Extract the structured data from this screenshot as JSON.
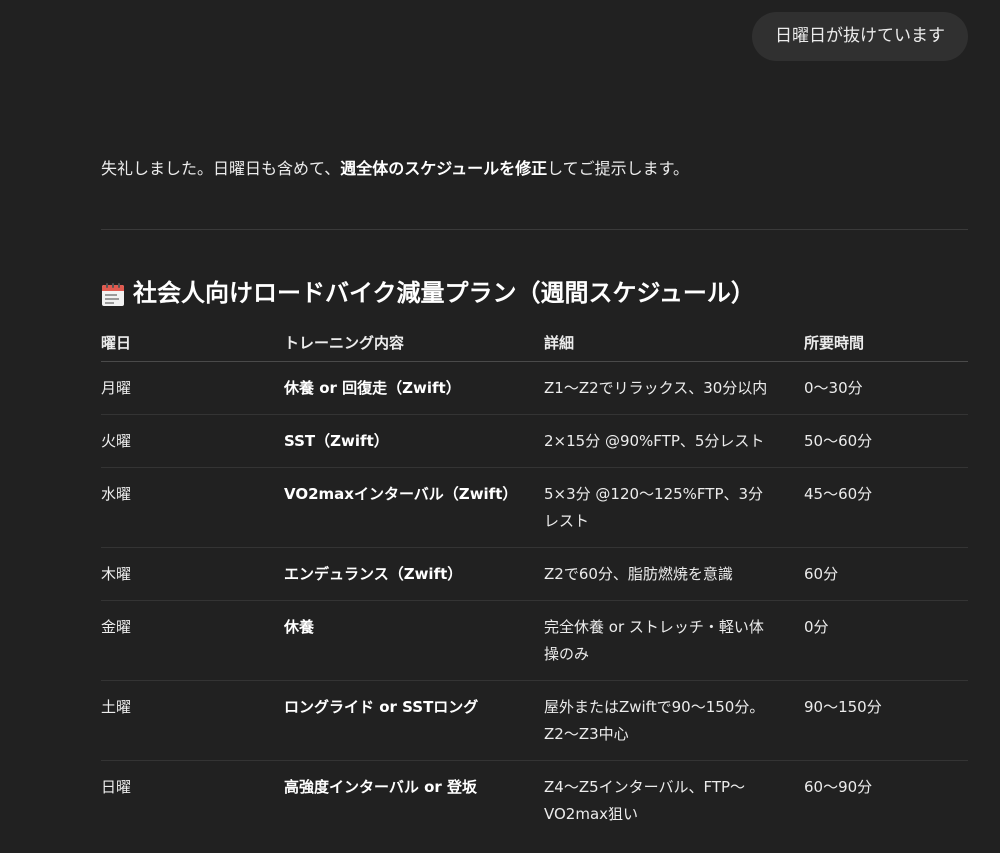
{
  "user_message": "日曜日が抜けています",
  "assistant": {
    "intro_before": "失礼しました。日曜日も含めて、",
    "intro_bold": "週全体のスケジュールを修正",
    "intro_after": "してご提示します。",
    "heading_icon": "calendar-icon",
    "heading": "社会人向けロードバイク減量プラン（週間スケジュール）"
  },
  "table": {
    "headers": [
      "曜日",
      "トレーニング内容",
      "詳細",
      "所要時間"
    ],
    "rows": [
      {
        "day": "月曜",
        "training": "休養 or 回復走（Zwift）",
        "detail": "Z1〜Z2でリラックス、30分以内",
        "duration": "0〜30分"
      },
      {
        "day": "火曜",
        "training": "SST（Zwift）",
        "detail": "2×15分 @90%FTP、5分レスト",
        "duration": "50〜60分"
      },
      {
        "day": "水曜",
        "training": "VO2maxインターバル（Zwift）",
        "detail": "5×3分 @120〜125%FTP、3分レスト",
        "duration": "45〜60分"
      },
      {
        "day": "木曜",
        "training": "エンデュランス（Zwift）",
        "detail": "Z2で60分、脂肪燃焼を意識",
        "duration": "60分"
      },
      {
        "day": "金曜",
        "training": "休養",
        "detail": "完全休養 or ストレッチ・軽い体操のみ",
        "duration": "0分"
      },
      {
        "day": "土曜",
        "training": "ロングライド or SSTロング",
        "detail": "屋外またはZwiftで90〜150分。Z2〜Z3中心",
        "duration": "90〜150分"
      },
      {
        "day": "日曜",
        "training": "高強度インターバル or 登坂",
        "detail": "Z4〜Z5インターバル、FTP〜VO2max狙い",
        "duration": "60〜90分"
      }
    ]
  }
}
